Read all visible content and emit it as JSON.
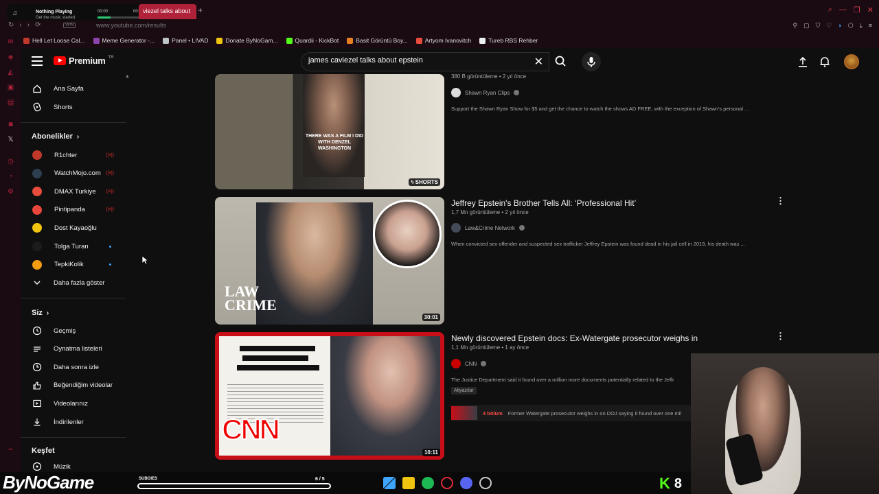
{
  "media_widget": {
    "title": "Nothing Playing",
    "subtitle": "Get the music started",
    "time_start": "00:00",
    "time_end": "00:00"
  },
  "browser": {
    "active_tab": "viezel talks about",
    "url": "www.youtube.com/results",
    "vpn_label": "VPN",
    "bookmarks": [
      {
        "label": "Hell Let Loose Cal...",
        "color": "#c0392b"
      },
      {
        "label": "Meme Generator -...",
        "color": "#8e44ad"
      },
      {
        "label": "Panel • LIVAD",
        "color": "#bdc3c7"
      },
      {
        "label": "Donate ByNoGam...",
        "color": "#f1c40f"
      },
      {
        "label": "Quardii - KickBot",
        "color": "#53fc18"
      },
      {
        "label": "Basit Görüntü Boy...",
        "color": "#e67e22"
      },
      {
        "label": "Artyom Ivanovitch",
        "color": "#e74c3c"
      },
      {
        "label": "Tureb RBS Rehber",
        "color": "#ecf0f1"
      }
    ]
  },
  "youtube": {
    "logo_text": "Premium",
    "logo_region": "TR",
    "search": {
      "query": "james caviezel talks about epstein"
    },
    "sidebar": {
      "home": "Ana Sayfa",
      "shorts": "Shorts",
      "subscriptions_header": "Abonelikler",
      "channels": [
        {
          "name": "R1chter",
          "color": "#c0392b",
          "badge": "live"
        },
        {
          "name": "WatchMojo.com",
          "color": "#2c3e50",
          "badge": "live"
        },
        {
          "name": "DMAX Turkiye",
          "color": "#e74c3c",
          "badge": "live"
        },
        {
          "name": "Pintipanda",
          "color": "#e8453c",
          "badge": "live"
        },
        {
          "name": "Dost Kayaoğlu",
          "color": "#f1c40f",
          "badge": ""
        },
        {
          "name": "Tolga Turan",
          "color": "#1c1c1c",
          "badge": "new"
        },
        {
          "name": "TepkiKolik",
          "color": "#f39c12",
          "badge": "new"
        }
      ],
      "show_more": "Daha fazla göster",
      "you_header": "Siz",
      "you_items": [
        "Geçmiş",
        "Oynatma listeleri",
        "Daha sonra izle",
        "Beğendiğim videolar",
        "Videolarınız",
        "İndirilenler"
      ],
      "explore_header": "Keşfet",
      "explore_items": [
        "Müzik"
      ]
    },
    "results": [
      {
        "meta": "380 B görüntüleme • 2 yıl önce",
        "channel": "Shawn Ryan Clips",
        "channel_color": "#dddddd",
        "description": "Support the Shawn Ryan Show for $5 and get the chance to watch the shows AD FREE, with the exception of Shawn's personal ...",
        "badge": "SHORTS",
        "caption": "THERE WAS A FILM I DID WITH DENZEL WASHINGTON"
      },
      {
        "title": "Jeffrey Epstein's Brother Tells All: ‘Professional Hit’",
        "meta": "1,7 Mn görüntüleme • 2 yıl önce",
        "channel": "Law&Crime Network",
        "channel_color": "#444b5a",
        "description": "When convicted sex offender and suspected sex trafficker Jeffrey Epstein was found dead in his jail cell in 2019, his death was ...",
        "duration": "30:01",
        "thumb_text_1": "LAW",
        "thumb_text_2": "CRIME"
      },
      {
        "title": "Newly discovered Epstein docs: Ex-Watergate prosecutor weighs in",
        "meta": "1,1 Mn görüntüleme • 1 ay önce",
        "channel": "CNN",
        "channel_color": "#cc0000",
        "description": "The Justice Department said it found over a million more documents potentially related to the Jeffr",
        "tag": "Altyazılar",
        "chapter_count": "4 bölüm",
        "chapter_text": "Former Watergate prosecutor weighs in on DOJ saying it found over one mil",
        "duration": "10:11",
        "thumb_text": "CNN"
      }
    ]
  },
  "overlay": {
    "logo": "ByNoGame",
    "subs_label": "SUBGIES",
    "subs_count": "6 / 5",
    "kick_count": "8"
  },
  "colors": {
    "accent": "#b0223a",
    "yt_red": "#ff0000",
    "kick_green": "#53fc18"
  }
}
